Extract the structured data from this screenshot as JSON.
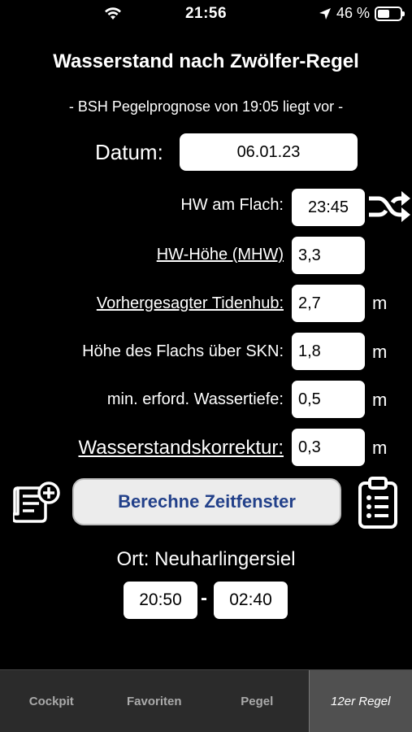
{
  "status_bar": {
    "time": "21:56",
    "battery": "46 %"
  },
  "header": {
    "title": "Wasserstand nach Zwölfer-Regel",
    "subtitle": "- BSH Pegelprognose von 19:05 liegt vor -"
  },
  "date": {
    "label": "Datum:",
    "value": "06.01.23"
  },
  "form": {
    "hw_label": "HW am Flach:",
    "hw_value": "23:45",
    "hwh_label": "HW-Höhe (MHW)",
    "hwh_value": "3,3",
    "tide_label": "Vorhergesagter Tidenhub:",
    "tide_value": "2,7",
    "tide_unit": "m",
    "skn_label": "Höhe des Flachs über SKN:",
    "skn_value": "1,8",
    "skn_unit": "m",
    "depth_label": "min. erford. Wassertiefe:",
    "depth_value": "0,5",
    "depth_unit": "m",
    "corr_label": "Wasserstandskorrektur:",
    "corr_value": "0,3",
    "corr_unit": "m"
  },
  "actions": {
    "calc_label": "Berechne Zeitfenster"
  },
  "result": {
    "ort": "Ort: Neuharlingersiel",
    "from": "20:50",
    "separator": "-",
    "to": "02:40"
  },
  "tabs": [
    {
      "label": "Cockpit"
    },
    {
      "label": "Favoriten"
    },
    {
      "label": "Pegel"
    },
    {
      "label": "12er Regel"
    }
  ],
  "colors": {
    "accent": "#23418a",
    "background": "#000000",
    "tabbar": "#2b2b2b"
  }
}
